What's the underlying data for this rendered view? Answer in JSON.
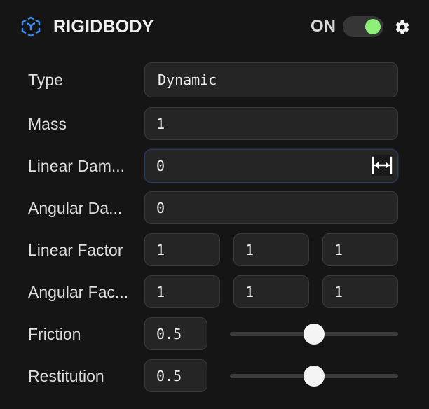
{
  "header": {
    "title": "RIGIDBODY",
    "on_label": "ON",
    "toggle_on": true,
    "accent_color": "#8ef07a",
    "icon": "cube-icon",
    "settings_icon": "gear-icon"
  },
  "rows": {
    "type": {
      "label": "Type",
      "value": "Dynamic"
    },
    "mass": {
      "label": "Mass",
      "value": "1"
    },
    "linear_damping": {
      "label": "Linear Dam...",
      "value": "0"
    },
    "angular_damping": {
      "label": "Angular Da...",
      "value": "0"
    },
    "linear_factor": {
      "label": "Linear Factor",
      "x": "1",
      "y": "1",
      "z": "1"
    },
    "angular_factor": {
      "label": "Angular Fac...",
      "x": "1",
      "y": "1",
      "z": "1"
    },
    "friction": {
      "label": "Friction",
      "value": "0.5",
      "slider_fraction": 0.5
    },
    "restitution": {
      "label": "Restitution",
      "value": "0.5",
      "slider_fraction": 0.5
    }
  }
}
